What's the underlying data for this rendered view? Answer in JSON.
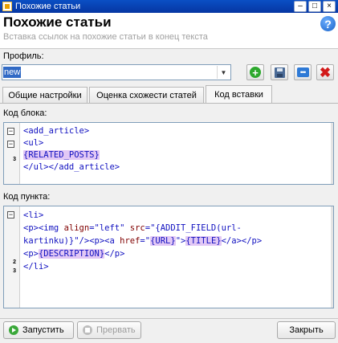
{
  "window": {
    "title": "Похожие статьи"
  },
  "header": {
    "title": "Похожие статьи",
    "subtitle": "Вставка ссылок на похожие статьи в конец текста"
  },
  "profile": {
    "label": "Профиль:",
    "value": "new"
  },
  "toolbar": {
    "add": "add-icon",
    "save": "save-icon",
    "more": "more-icon",
    "delete": "delete-icon"
  },
  "tabs": [
    {
      "label": "Общие настройки"
    },
    {
      "label": "Оценка схожести статей"
    },
    {
      "label": "Код вставки",
      "active": true
    }
  ],
  "block_code": {
    "label": "Код блока:",
    "line_numbers": [
      "3"
    ],
    "lines": [
      [
        {
          "t": "<add_article>",
          "c": "tag"
        }
      ],
      [
        {
          "t": "<ul>",
          "c": "tag"
        }
      ],
      [
        {
          "t": "{RELATED_POSTS}",
          "c": "ph"
        }
      ],
      [
        {
          "t": "</ul></add_article>",
          "c": "tag"
        }
      ]
    ]
  },
  "item_code": {
    "label": "Код пункта:",
    "line_numbers": [
      "2",
      "3"
    ],
    "lines": [
      [
        {
          "t": "<li>",
          "c": "tag"
        }
      ],
      [
        {
          "t": "<p><img ",
          "c": "tag"
        },
        {
          "t": "align",
          "c": "attr"
        },
        {
          "t": "=",
          "c": "tag"
        },
        {
          "t": "\"left\"",
          "c": "str"
        },
        {
          "t": " ",
          "c": ""
        },
        {
          "t": "src",
          "c": "attr"
        },
        {
          "t": "=",
          "c": "tag"
        },
        {
          "t": "\"{ADDIT_FIELD(url-",
          "c": "str"
        }
      ],
      [
        {
          "t": "kartinku)}\"",
          "c": "str"
        },
        {
          "t": "/><p><a ",
          "c": "tag"
        },
        {
          "t": "href",
          "c": "attr"
        },
        {
          "t": "=",
          "c": "tag"
        },
        {
          "t": "\"",
          "c": "str"
        },
        {
          "t": "{URL}",
          "c": "ph"
        },
        {
          "t": "\"",
          "c": "str"
        },
        {
          "t": ">",
          "c": "tag"
        },
        {
          "t": "{TITLE}",
          "c": "ph"
        },
        {
          "t": "</a></p>",
          "c": "tag"
        }
      ],
      [
        {
          "t": "<p>",
          "c": "tag"
        },
        {
          "t": "{DESCRIPTION}",
          "c": "ph"
        },
        {
          "t": "</p>",
          "c": "tag"
        }
      ],
      [
        {
          "t": "</li>",
          "c": "tag"
        }
      ]
    ]
  },
  "footer": {
    "run_label": "Запустить",
    "stop_label": "Прервать",
    "close_label": "Закрыть"
  }
}
